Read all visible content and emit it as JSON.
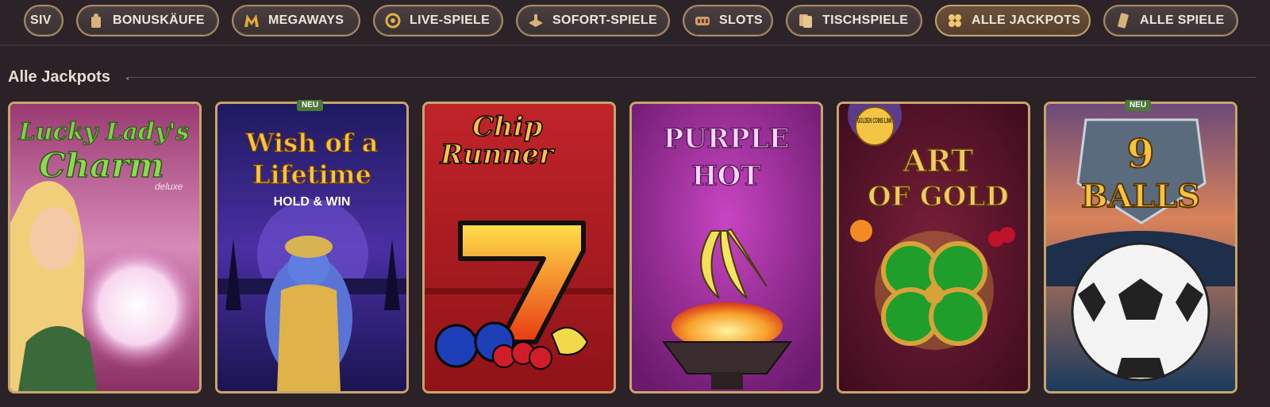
{
  "nav": {
    "items": [
      {
        "label": "SIV",
        "icon": "partial-icon"
      },
      {
        "label": "BONUSKÄUFE",
        "icon": "bonus-buy-icon"
      },
      {
        "label": "MEGAWAYS",
        "icon": "megaways-icon"
      },
      {
        "label": "LIVE-SPIELE",
        "icon": "live-icon"
      },
      {
        "label": "SOFORT-SPIELE",
        "icon": "instant-icon"
      },
      {
        "label": "SLOTS",
        "icon": "slots-icon"
      },
      {
        "label": "TISCHSPIELE",
        "icon": "table-games-icon"
      },
      {
        "label": "ALLE JACKPOTS",
        "icon": "jackpot-icon",
        "active": true
      },
      {
        "label": "ALLE SPIELE",
        "icon": "all-games-icon"
      }
    ]
  },
  "section": {
    "title": "Alle Jackpots"
  },
  "games": [
    {
      "title_line1": "Lucky Lady's",
      "title_line2": "Charm",
      "sub": "deluxe",
      "badge": ""
    },
    {
      "title_line1": "Wish of a",
      "title_line2": "Lifetime",
      "sub": "HOLD & WIN",
      "badge": "NEU"
    },
    {
      "title_line1": "Chip",
      "title_line2": "Runner",
      "sub": "",
      "badge": ""
    },
    {
      "title_line1": "PURPLE",
      "title_line2": "HOT",
      "sub": "",
      "badge": ""
    },
    {
      "title_line1": "ART",
      "title_line2": "OF GOLD",
      "sub": "GOLDEN COINS LINK",
      "badge": ""
    },
    {
      "title_line1": "9",
      "title_line2": "BALLS",
      "sub": "",
      "badge": "NEU"
    }
  ],
  "colors": {
    "accent_gold": "#c6a46b",
    "badge_green": "#4d7a3b",
    "background": "#2a2227"
  }
}
